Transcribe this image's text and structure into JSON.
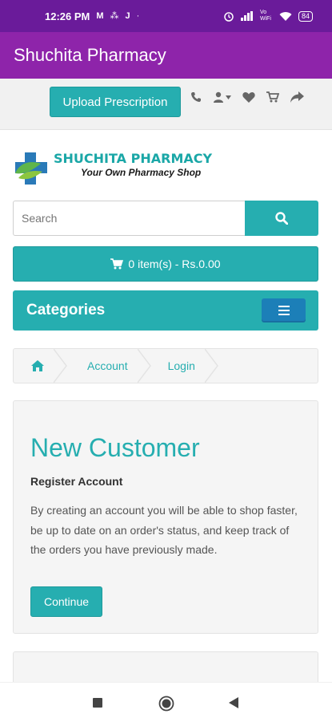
{
  "status_bar": {
    "time": "12:26 PM",
    "notif_icons": [
      "M",
      "⁂",
      "J",
      "·"
    ],
    "net_label": "Vo WiFi",
    "battery": "84"
  },
  "app_bar": {
    "title": "Shuchita Pharmacy"
  },
  "top_bar": {
    "upload_label": "Upload Prescription",
    "icons": [
      "phone-icon",
      "user-icon",
      "heart-icon",
      "cart-icon",
      "share-icon"
    ]
  },
  "logo": {
    "name": "SHUCHITA PHARMACY",
    "tagline": "Your Own Pharmacy Shop"
  },
  "search": {
    "placeholder": "Search"
  },
  "cart": {
    "label": "0 item(s) - Rs.0.00"
  },
  "categories": {
    "label": "Categories"
  },
  "breadcrumb": {
    "items": [
      "Account",
      "Login"
    ]
  },
  "new_customer": {
    "heading": "New Customer",
    "subheading": "Register Account",
    "description": "By creating an account you will be able to shop faster, be up to date on an order's status, and keep track of the orders you have previously made.",
    "continue_label": "Continue"
  },
  "colors": {
    "accent": "#26aeb0",
    "app_bar": "#8e24aa",
    "status_bar": "#6a1b9a",
    "toggle": "#1c7fb8"
  }
}
